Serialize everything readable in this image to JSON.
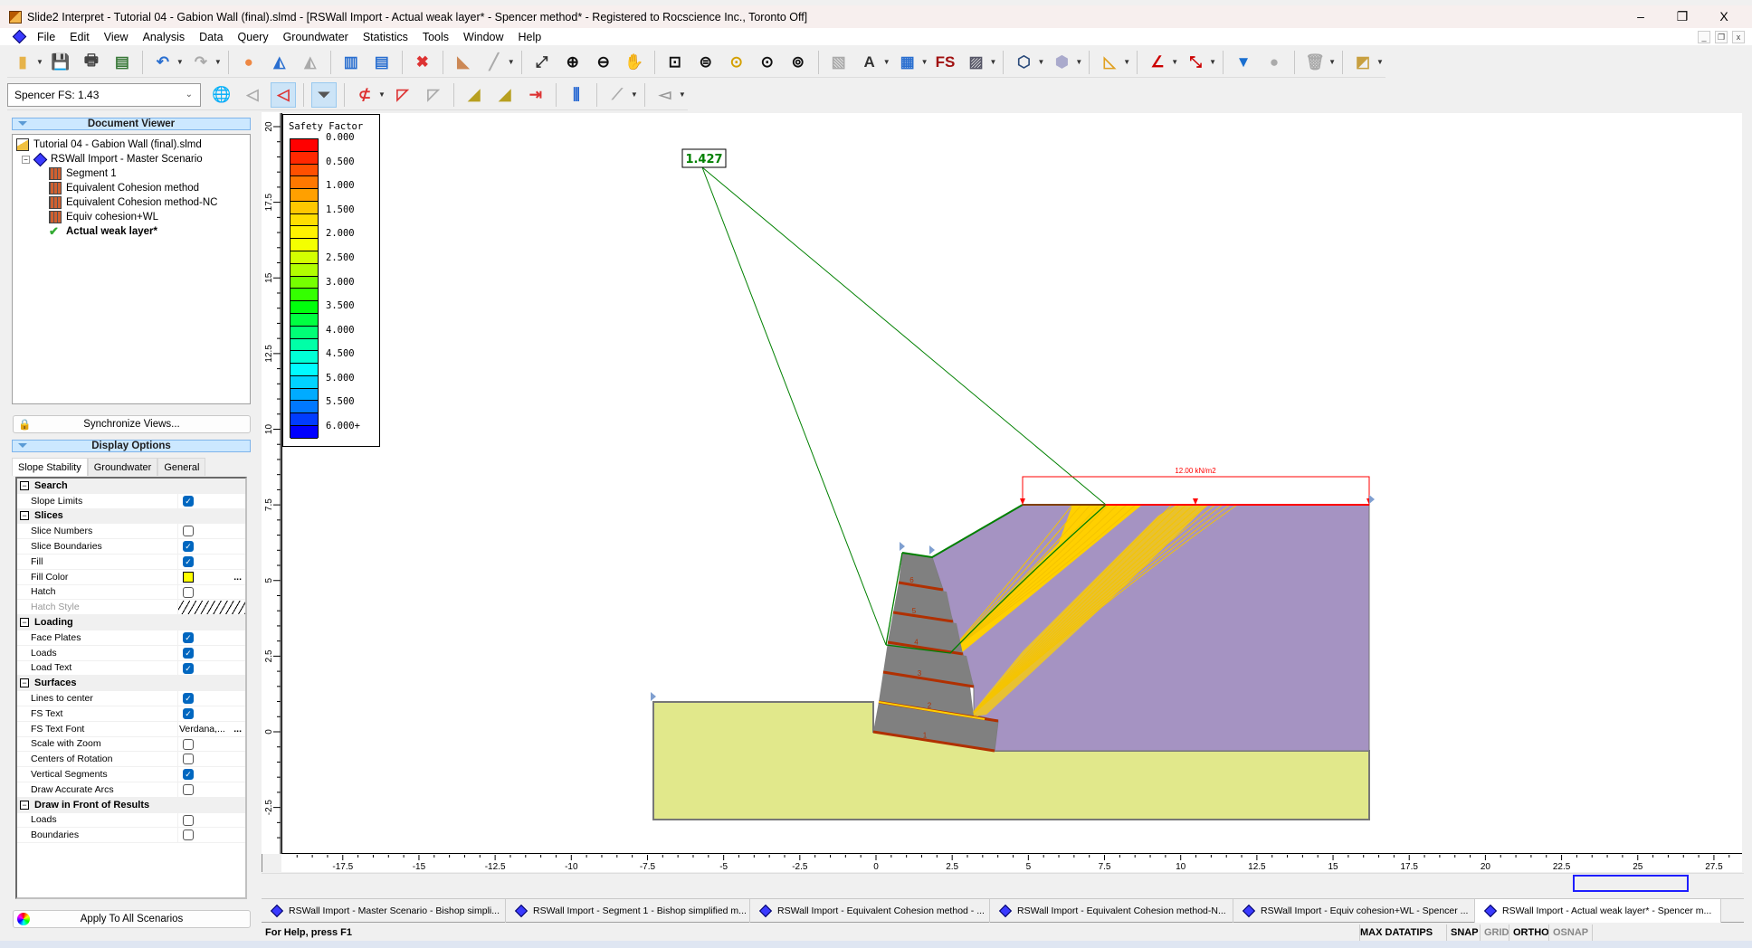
{
  "window": {
    "title": "Slide2 Interpret - Tutorial 04 - Gabion Wall (final).slmd - [RSWall Import - Actual weak layer* - Spencer method* - Registered to Rocscience Inc., Toronto Off]",
    "minimize": "–",
    "restore": "❐",
    "close": "X"
  },
  "menu": [
    "File",
    "Edit",
    "View",
    "Analysis",
    "Data",
    "Query",
    "Groundwater",
    "Statistics",
    "Tools",
    "Window",
    "Help"
  ],
  "mdi_buttons": [
    "_",
    "❐",
    "x"
  ],
  "toolbar1": [
    {
      "icon": "open-folder-icon",
      "glyph": "▮",
      "color": "#e6b34a",
      "dropdown": true
    },
    {
      "icon": "save-icon",
      "glyph": "💾",
      "color": "#2b3a55"
    },
    {
      "icon": "print-icon",
      "glyph": "🖶",
      "color": "#444"
    },
    {
      "icon": "print-preview-icon",
      "glyph": "▤",
      "color": "#3a7a3a",
      "sep": true
    },
    {
      "icon": "undo-icon",
      "glyph": "↶",
      "color": "#2a6fd0",
      "dropdown": true
    },
    {
      "icon": "redo-icon",
      "glyph": "↷",
      "color": "#aaa",
      "dropdown": true,
      "sep": true
    },
    {
      "icon": "color-wheel-icon",
      "glyph": "●",
      "color": "#e84"
    },
    {
      "icon": "contours-icon",
      "glyph": "◭",
      "color": "#2a6fd0"
    },
    {
      "icon": "groundwater-contours-icon",
      "glyph": "◭",
      "color": "#aaa",
      "sep": true
    },
    {
      "icon": "tile-vertical-icon",
      "glyph": "▥",
      "color": "#2a6fd0"
    },
    {
      "icon": "tile-horizontal-icon",
      "glyph": "▤",
      "color": "#2a6fd0",
      "sep": true
    },
    {
      "icon": "close-window-icon",
      "glyph": "✖",
      "color": "#d33",
      "sep": true
    },
    {
      "icon": "slope-view-icon",
      "glyph": "◣",
      "color": "#c85"
    },
    {
      "icon": "water-table-icon",
      "glyph": "╱",
      "color": "#aaa",
      "dropdown": true,
      "sep": true
    },
    {
      "icon": "zoom-extents-icon",
      "glyph": "⤢",
      "color": "#333"
    },
    {
      "icon": "zoom-in-icon",
      "glyph": "⊕",
      "color": "#111"
    },
    {
      "icon": "zoom-out-icon",
      "glyph": "⊖",
      "color": "#111"
    },
    {
      "icon": "pan-icon",
      "glyph": "✋",
      "color": "#c96",
      "sep": true
    },
    {
      "icon": "zoom-window-icon",
      "glyph": "⊡",
      "color": "#111"
    },
    {
      "icon": "zoom-slope-icon",
      "glyph": "⊜",
      "color": "#111"
    },
    {
      "icon": "zoom-previous-icon",
      "glyph": "⊙",
      "color": "#d4a000"
    },
    {
      "icon": "zoom-bookmark-icon",
      "glyph": "⊙",
      "color": "#111"
    },
    {
      "icon": "zoom-lock-icon",
      "glyph": "⊚",
      "color": "#111",
      "sep": true
    },
    {
      "icon": "data-tips-icon",
      "glyph": "▧",
      "color": "#aaa"
    },
    {
      "icon": "text-box-icon",
      "glyph": "A",
      "color": "#333",
      "dropdown": true
    },
    {
      "icon": "table-icon",
      "glyph": "▦",
      "color": "#2a6fd0",
      "dropdown": true
    },
    {
      "icon": "fs-icon",
      "glyph": "FS",
      "color": "#a01010"
    },
    {
      "icon": "image-icon",
      "glyph": "▨",
      "color": "#556",
      "dropdown": true,
      "sep": true
    },
    {
      "icon": "polyline-icon",
      "glyph": "⬡",
      "color": "#2a4a7a",
      "dropdown": true
    },
    {
      "icon": "polygon-icon",
      "glyph": "⬢",
      "color": "#aac",
      "dropdown": true,
      "sep": true
    },
    {
      "icon": "ruler-icon",
      "glyph": "◺",
      "color": "#e0a020",
      "dropdown": true,
      "sep": true
    },
    {
      "icon": "angle-icon",
      "glyph": "∠",
      "color": "#c00",
      "dropdown": true
    },
    {
      "icon": "dimension-icon",
      "glyph": "⤡",
      "color": "#c00",
      "dropdown": true,
      "sep": true
    },
    {
      "icon": "water-level-icon",
      "glyph": "▼",
      "color": "#1a6fd0"
    },
    {
      "icon": "gray-circle-icon",
      "glyph": "●",
      "color": "#aaa",
      "sep": true
    },
    {
      "icon": "delete-icon",
      "glyph": "🗑",
      "color": "#aaa",
      "dropdown": true,
      "sep": true
    },
    {
      "icon": "layers-icon",
      "glyph": "◩",
      "color": "#c8a040",
      "dropdown": true
    }
  ],
  "fs_select": {
    "value": "Spencer FS:  1.43"
  },
  "toolbar2": [
    {
      "icon": "globe-icon",
      "glyph": "🌐",
      "color": "#2a7"
    },
    {
      "icon": "minimum-surface-icon",
      "glyph": "◁",
      "color": "#aaa"
    },
    {
      "icon": "all-surfaces-icon",
      "glyph": "◁",
      "color": "#d33",
      "active": true,
      "sep": true
    },
    {
      "icon": "filter-surfaces-icon",
      "glyph": "⏷",
      "color": "#555",
      "active": true,
      "sep": true
    },
    {
      "icon": "add-surface-icon",
      "glyph": "⊄",
      "color": "#d33",
      "dropdown": true
    },
    {
      "icon": "surface-icon",
      "glyph": "◸",
      "color": "#d33"
    },
    {
      "icon": "delete-surface-icon",
      "glyph": "◸",
      "color": "#aaa",
      "sep": true
    },
    {
      "icon": "slices-icon",
      "glyph": "◢",
      "color": "#b8a020"
    },
    {
      "icon": "slice-data-icon",
      "glyph": "◢",
      "color": "#b8a020"
    },
    {
      "icon": "slice-forces-icon",
      "glyph": "⇥",
      "color": "#d33",
      "sep": true
    },
    {
      "icon": "histogram-icon",
      "glyph": "⫼",
      "color": "#1a5fd0",
      "sep": true
    },
    {
      "icon": "query-line-icon",
      "glyph": "⟋",
      "color": "#aaa",
      "dropdown": true,
      "sep": true
    },
    {
      "icon": "sensitivity-icon",
      "glyph": "◅",
      "color": "#999",
      "dropdown": true
    }
  ],
  "document_viewer": {
    "header": "Document Viewer",
    "file": "Tutorial 04 - Gabion Wall (final).slmd",
    "master": "RSWall Import - Master Scenario",
    "scenarios": [
      "Segment 1",
      "Equivalent Cohesion method",
      "Equivalent Cohesion method-NC",
      "Equiv cohesion+WL"
    ],
    "active_scenario": "Actual weak layer*"
  },
  "sync_button": "Synchronize Views...",
  "display_options": {
    "header": "Display Options",
    "tabs": [
      "Slope Stability",
      "Groundwater",
      "General"
    ],
    "rows": [
      {
        "label": "Search",
        "cat": true
      },
      {
        "label": "Slope Limits",
        "type": "check",
        "checked": true
      },
      {
        "label": "Slices",
        "cat": true
      },
      {
        "label": "Slice Numbers",
        "type": "check",
        "checked": false
      },
      {
        "label": "Slice Boundaries",
        "type": "check",
        "checked": true
      },
      {
        "label": "Fill",
        "type": "check",
        "checked": true
      },
      {
        "label": "Fill Color",
        "type": "color",
        "color": "#ffff00",
        "more": "..."
      },
      {
        "label": "Hatch",
        "type": "check",
        "checked": false
      },
      {
        "label": "Hatch Style",
        "type": "hatch",
        "disabled": true
      },
      {
        "label": "Loading",
        "cat": true
      },
      {
        "label": "Face Plates",
        "type": "check",
        "checked": true
      },
      {
        "label": "Loads",
        "type": "check",
        "checked": true
      },
      {
        "label": "Load Text",
        "type": "check",
        "checked": true
      },
      {
        "label": "Surfaces",
        "cat": true
      },
      {
        "label": "Lines to center",
        "type": "check",
        "checked": true
      },
      {
        "label": "FS Text",
        "type": "check",
        "checked": true
      },
      {
        "label": "FS Text Font",
        "type": "text",
        "value": "Verdana,...",
        "more": "..."
      },
      {
        "label": "Scale with Zoom",
        "type": "check",
        "checked": false
      },
      {
        "label": "Centers of Rotation",
        "type": "check",
        "checked": false
      },
      {
        "label": "Vertical Segments",
        "type": "check",
        "checked": true
      },
      {
        "label": "Draw Accurate Arcs",
        "type": "check",
        "checked": false
      },
      {
        "label": "Draw in Front of Results",
        "cat": true
      },
      {
        "label": "Loads",
        "type": "check",
        "checked": false
      },
      {
        "label": "Boundaries",
        "type": "check",
        "checked": false
      }
    ]
  },
  "apply_button": "Apply To All Scenarios",
  "legend": {
    "title": "Safety Factor",
    "labels": [
      "0.000",
      "0.500",
      "1.000",
      "1.500",
      "2.000",
      "2.500",
      "3.000",
      "3.500",
      "4.000",
      "4.500",
      "5.000",
      "5.500",
      "6.000+"
    ],
    "color_stops": [
      "#ff0000",
      "#ff6600",
      "#ffcc00",
      "#ffff00",
      "#aaff00",
      "#00ff00",
      "#00ff88",
      "#00ffff",
      "#0099ff",
      "#0000ff"
    ]
  },
  "plot": {
    "fs_label": "1.427",
    "load_label": "12.00 kN/m2",
    "x_ticks": [
      "-17.5",
      "-15",
      "-12.5",
      "-10",
      "-7.5",
      "-5",
      "-2.5",
      "0",
      "2.5",
      "5",
      "7.5",
      "10",
      "12.5",
      "15",
      "17.5",
      "20",
      "22.5",
      "25",
      "27.5"
    ],
    "y_ticks": [
      "20",
      "17.5",
      "15",
      "12.5",
      "10",
      "7.5",
      "5",
      "2.5",
      "0",
      "-2.5"
    ],
    "block_numbers": [
      "1",
      "2",
      "3",
      "4",
      "5",
      "6"
    ],
    "colors": {
      "soil": "#e1e88b",
      "backfill": "#a593c2",
      "wall": "#808080",
      "slip_fill": "#ffd000",
      "critical": "#008000",
      "load": "#ff0000",
      "reinforcement": "#b03000"
    }
  },
  "doc_tabs": [
    "RSWall Import - Master Scenario - Bishop simpli...",
    "RSWall Import - Segment 1 - Bishop simplified m...",
    "RSWall Import - Equivalent Cohesion method - ...",
    "RSWall Import - Equivalent Cohesion method-N...",
    "RSWall Import - Equiv cohesion+WL - Spencer ...",
    "RSWall Import - Actual weak layer* - Spencer m..."
  ],
  "status": {
    "help": "For Help, press F1",
    "max_datatips": "MAX DATATIPS",
    "snap": "SNAP",
    "grid": "GRID",
    "ortho": "ORTHO",
    "osnap": "OSNAP"
  }
}
